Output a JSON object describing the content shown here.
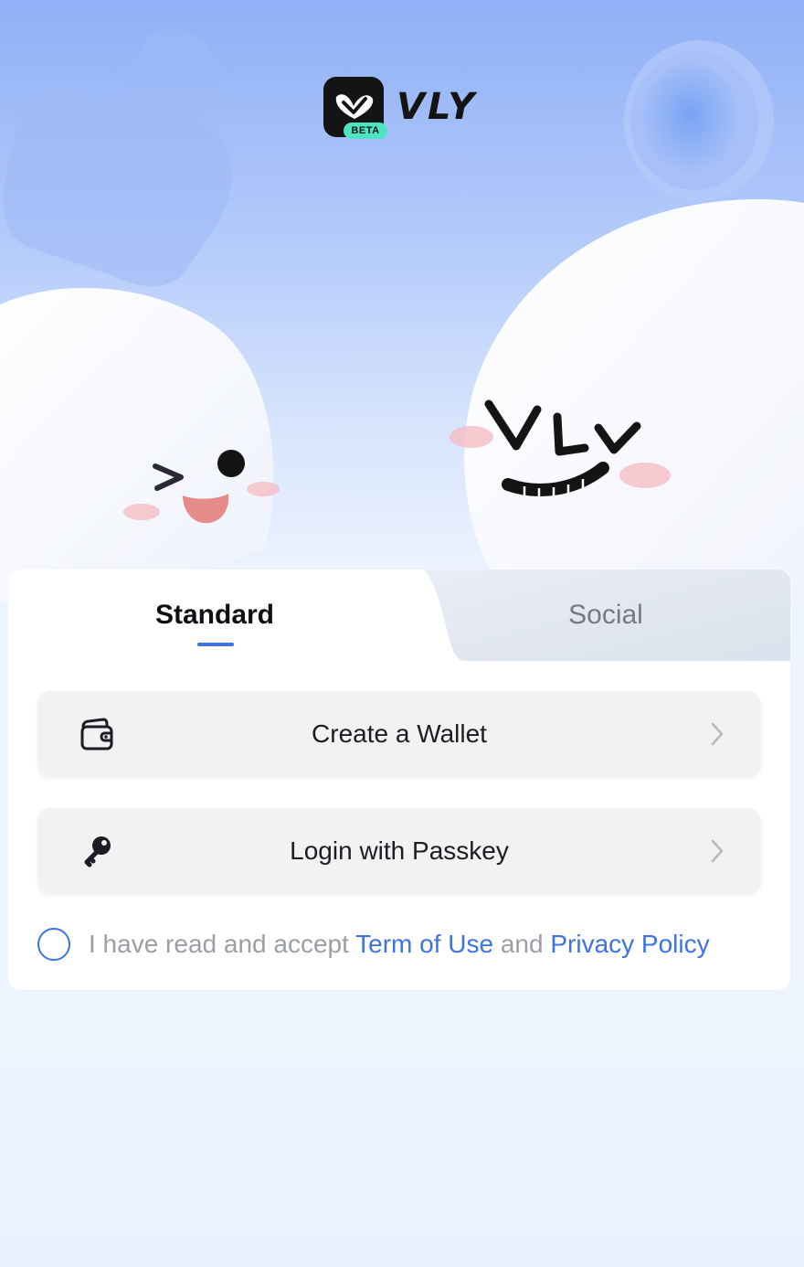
{
  "brand": {
    "name": "VLY",
    "badge": "BETA",
    "mascot_text": "VLY"
  },
  "tabs": [
    {
      "label": "Standard",
      "active": true
    },
    {
      "label": "Social",
      "active": false
    }
  ],
  "options": {
    "create_wallet": {
      "label": "Create a Wallet",
      "icon": "wallet-icon"
    },
    "passkey": {
      "label": "Login with Passkey",
      "icon": "key-icon"
    }
  },
  "terms": {
    "checked": false,
    "prefix": "I have read and accept ",
    "terms_link": "Term of Use",
    "and": " and ",
    "privacy_link": "Privacy Policy"
  },
  "colors": {
    "accent": "#3f73e4",
    "brand_badge": "#4fe3c1",
    "background_top": "#8fb0f7",
    "background_bottom": "#eef4fe"
  }
}
